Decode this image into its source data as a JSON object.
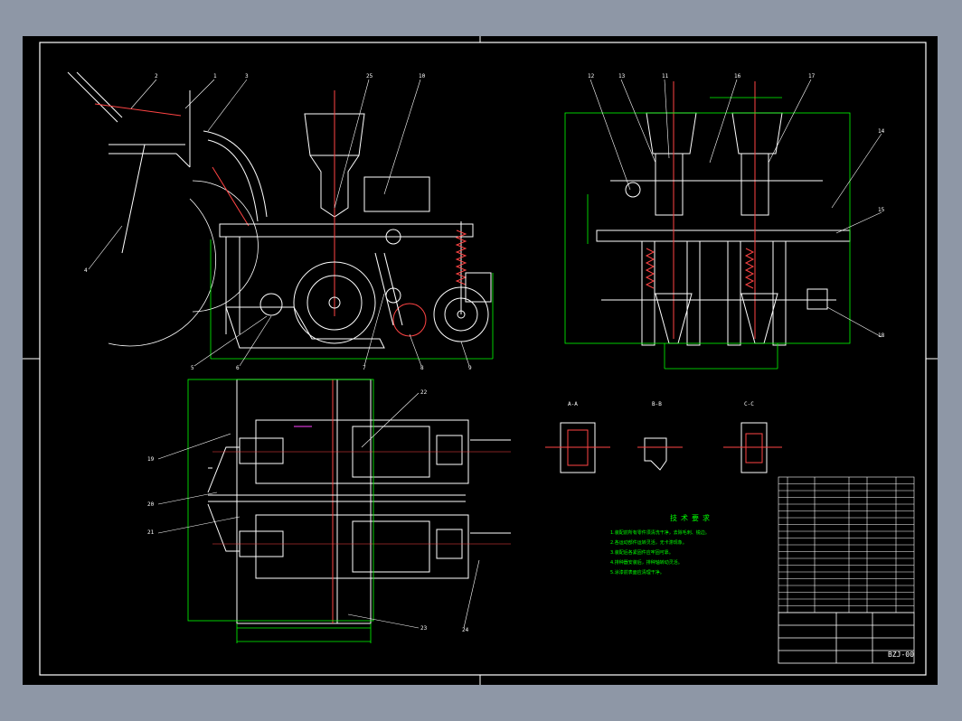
{
  "drawing_number": "BZJ-00",
  "balloons_side": [
    "1",
    "2",
    "3",
    "4",
    "5",
    "6",
    "7",
    "8",
    "9",
    "10",
    "25"
  ],
  "balloons_rear": [
    "11",
    "12",
    "13",
    "14",
    "15",
    "16",
    "17",
    "18"
  ],
  "balloons_top": [
    "19",
    "20",
    "21",
    "22",
    "23",
    "24"
  ],
  "section_marks": [
    "A-A",
    "B-B",
    "C-C"
  ],
  "notes_title": "技术要求",
  "notes": [
    "1.装配前所有零件须清洗干净，去除毛刺、锐边。",
    "2.各运动部件运转灵活，无卡滞现象。",
    "3.装配后各紧固件应牢固可靠。",
    "4.排种器安装后，排种轴转动灵活。",
    "5.涂漆前表面应清理干净。"
  ],
  "colors": {
    "background": "#000000",
    "lines": "#ffffff",
    "part": "#ff0000",
    "dimension": "#00ff00",
    "frame": "#ffffff"
  }
}
